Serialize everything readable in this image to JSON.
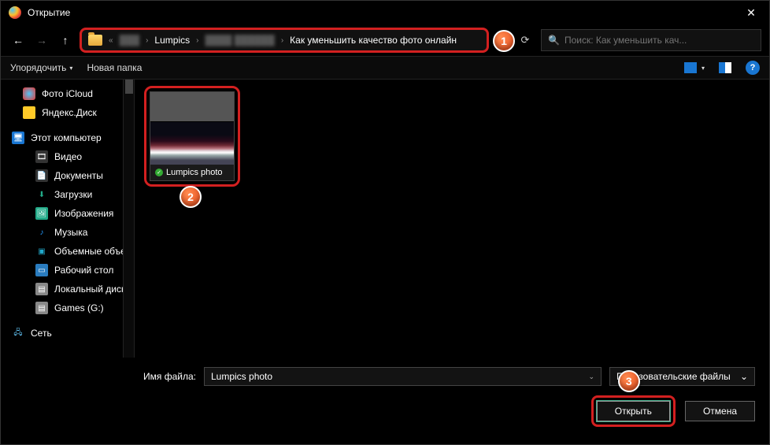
{
  "title": "Открытие",
  "breadcrumb": {
    "hidden1": "███",
    "seg1": "Lumpics",
    "hidden2": "████   ██████",
    "seg2": "Как уменьшить качество фото онлайн"
  },
  "search": {
    "placeholder": "Поиск: Как уменьшить кач..."
  },
  "toolbar": {
    "organize": "Упорядочить",
    "newfolder": "Новая папка"
  },
  "sidebar": {
    "icloud": "Фото iCloud",
    "yadisk": "Яндекс.Диск",
    "thispc": "Этот компьютер",
    "video": "Видео",
    "docs": "Документы",
    "downloads": "Загрузки",
    "pictures": "Изображения",
    "music": "Музыка",
    "objects3d": "Объемные объекты",
    "desktop": "Рабочий стол",
    "localdisk": "Локальный диск",
    "games": "Games (G:)",
    "network": "Сеть"
  },
  "file": {
    "name": "Lumpics photo"
  },
  "badges": {
    "b1": "1",
    "b2": "2",
    "b3": "3"
  },
  "footer": {
    "filename_label": "Имя файла:",
    "filename_value": "Lumpics photo",
    "filetype": "Пользовательские файлы",
    "open": "Открыть",
    "cancel": "Отмена"
  }
}
